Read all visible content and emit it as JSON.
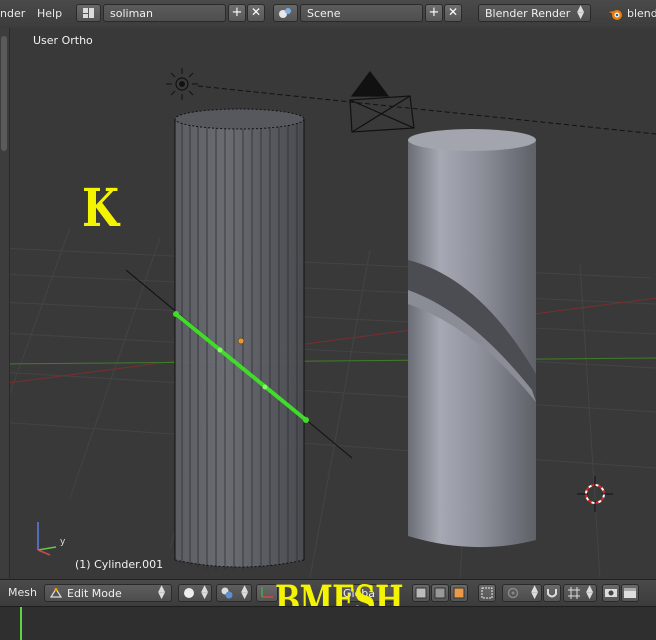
{
  "header": {
    "menu": [
      {
        "label": "nder"
      },
      {
        "label": "Help"
      }
    ],
    "screen_layout": {
      "value": "soliman",
      "icon": "screen-layout-icon"
    },
    "scene": {
      "value": "Scene",
      "icon": "scene-icon"
    },
    "render_engine": {
      "value": "Blender Render"
    },
    "blender_label": "blend"
  },
  "viewport": {
    "view_label": "User Ortho",
    "object_label": "(1) Cylinder.001",
    "overlay_key": "K",
    "axis_labels": {
      "y": "y"
    },
    "colors": {
      "grid": "#454545",
      "x_axis": "#7a2e2e",
      "y_axis": "#3f7d2a",
      "selected_edge": "#3fdc2a",
      "overlay_text": "#f4f400"
    }
  },
  "bottom_header": {
    "menu_label": "Mesh",
    "mode": {
      "value": "Edit Mode"
    },
    "orientation_partial": "Globa",
    "overlay_text": "BMESH"
  }
}
